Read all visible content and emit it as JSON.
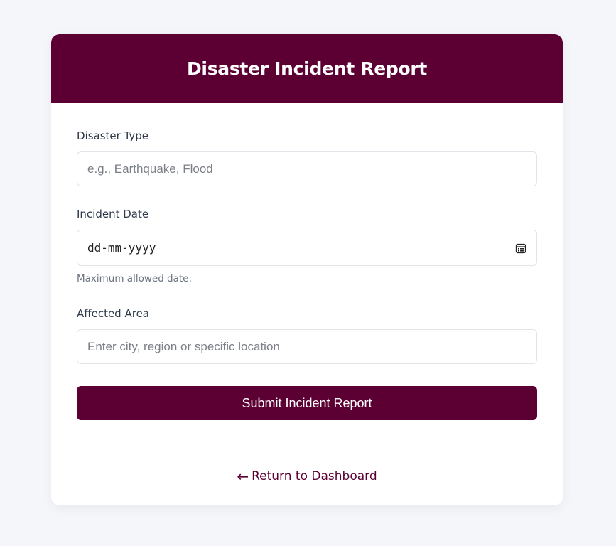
{
  "header": {
    "title": "Disaster Incident Report"
  },
  "form": {
    "disaster_type": {
      "label": "Disaster Type",
      "placeholder": "e.g., Earthquake, Flood",
      "value": ""
    },
    "incident_date": {
      "label": "Incident Date",
      "placeholder": "dd-mm-yyyy",
      "hint": "Maximum allowed date:",
      "icon": "calendar-icon"
    },
    "affected_area": {
      "label": "Affected Area",
      "placeholder": "Enter city, region or specific location",
      "value": ""
    },
    "submit_label": "Submit Incident Report"
  },
  "footer": {
    "back_arrow": "←",
    "back_label": "Return to Dashboard"
  },
  "colors": {
    "accent": "#5c0033",
    "background": "#f5f6fa"
  }
}
